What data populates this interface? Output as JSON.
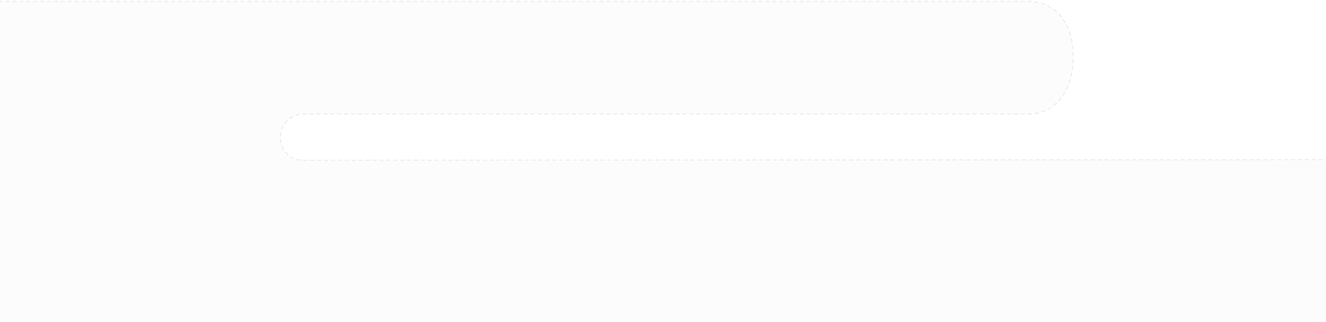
{
  "colors": {
    "page_background": "#ffffff",
    "shape_fill": "#fcfcfc",
    "dashed_stroke": "#e3e3e3"
  }
}
